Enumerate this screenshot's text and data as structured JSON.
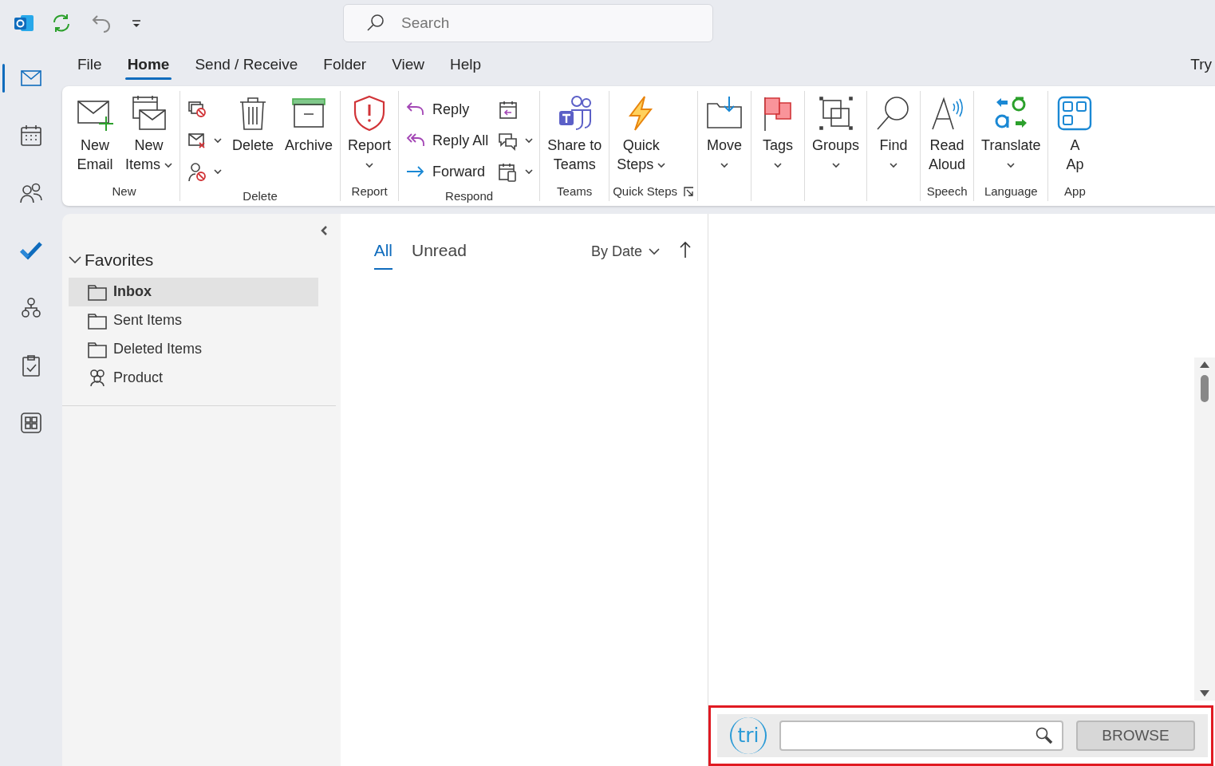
{
  "quick_access": {
    "search": {
      "placeholder": "Search"
    }
  },
  "nav_rail": [
    {
      "selected": true
    },
    {
      "selected": false
    },
    {
      "selected": false
    },
    {
      "selected": false
    },
    {
      "selected": false
    },
    {
      "selected": false
    },
    {
      "selected": false
    }
  ],
  "menu_tabs": [
    {
      "label": "File",
      "selected": false
    },
    {
      "label": "Home",
      "selected": true
    },
    {
      "label": "Send / Receive",
      "selected": false
    },
    {
      "label": "Folder",
      "selected": false
    },
    {
      "label": "View",
      "selected": false
    },
    {
      "label": "Help",
      "selected": false
    }
  ],
  "try_text": "Try",
  "ribbon": [
    {
      "label": "New",
      "items": [
        {
          "kind": "large",
          "lines": [
            "New",
            "Email"
          ],
          "dropdown": false
        },
        {
          "kind": "large",
          "lines": [
            "New",
            "Items"
          ],
          "dropdown": true
        }
      ]
    },
    {
      "label": "Delete",
      "items": [
        {
          "kind": "stack",
          "items": [
            {
              "dropdown": false
            },
            {
              "dropdown": true
            },
            {
              "dropdown": true
            }
          ]
        },
        {
          "kind": "large",
          "lines": [
            "Delete"
          ],
          "dropdown": false
        },
        {
          "kind": "large",
          "lines": [
            "Archive"
          ],
          "dropdown": false
        }
      ]
    },
    {
      "label": "Report",
      "items": [
        {
          "kind": "large",
          "lines": [
            "Report"
          ],
          "dropdown": true
        }
      ]
    },
    {
      "label": "Respond",
      "items": [
        {
          "kind": "stack",
          "items": [
            {
              "label": "Reply",
              "dropdown": false
            },
            {
              "label": "Reply All",
              "dropdown": false
            },
            {
              "label": "Forward",
              "dropdown": false
            }
          ]
        },
        {
          "kind": "stack",
          "items": [
            {
              "dropdown": false
            },
            {
              "dropdown": true
            },
            {
              "dropdown": true
            }
          ]
        }
      ]
    },
    {
      "label": "Teams",
      "items": [
        {
          "kind": "large",
          "lines": [
            "Share to",
            "Teams"
          ],
          "dropdown": false
        }
      ]
    },
    {
      "label": "Quick Steps",
      "launcher": true,
      "items": [
        {
          "kind": "large",
          "lines": [
            "Quick",
            "Steps"
          ],
          "dropdown": true
        }
      ]
    },
    {
      "items": [
        {
          "kind": "large",
          "lines": [
            "Move"
          ],
          "dropdown": true
        }
      ]
    },
    {
      "items": [
        {
          "kind": "large",
          "lines": [
            "Tags"
          ],
          "dropdown": true
        }
      ]
    },
    {
      "items": [
        {
          "kind": "large",
          "lines": [
            "Groups"
          ],
          "dropdown": true
        }
      ]
    },
    {
      "items": [
        {
          "kind": "large",
          "lines": [
            "Find"
          ],
          "dropdown": true
        }
      ]
    },
    {
      "label": "Speech",
      "items": [
        {
          "kind": "large",
          "lines": [
            "Read",
            "Aloud"
          ],
          "dropdown": false
        }
      ]
    },
    {
      "label": "Language",
      "items": [
        {
          "kind": "large",
          "lines": [
            "Translate"
          ],
          "dropdown": true
        }
      ]
    },
    {
      "label": "App",
      "items": [
        {
          "kind": "large",
          "lines": [
            "A",
            "Ap"
          ],
          "dropdown": false
        }
      ]
    }
  ],
  "folder_pane": {
    "heading": "Favorites",
    "expanded": true,
    "folders": [
      {
        "label": "Inbox",
        "kind": "folder",
        "selected": true
      },
      {
        "label": "Sent Items",
        "kind": "folder",
        "selected": false
      },
      {
        "label": "Deleted Items",
        "kind": "folder",
        "selected": false
      },
      {
        "label": "Product",
        "kind": "group",
        "selected": false
      }
    ]
  },
  "message_list": {
    "filters": [
      {
        "label": "All",
        "selected": true
      },
      {
        "label": "Unread",
        "selected": false
      }
    ],
    "sort": "By Date"
  },
  "addin": {
    "logo": "tri",
    "button": "BROWSE",
    "highlighted": true
  }
}
